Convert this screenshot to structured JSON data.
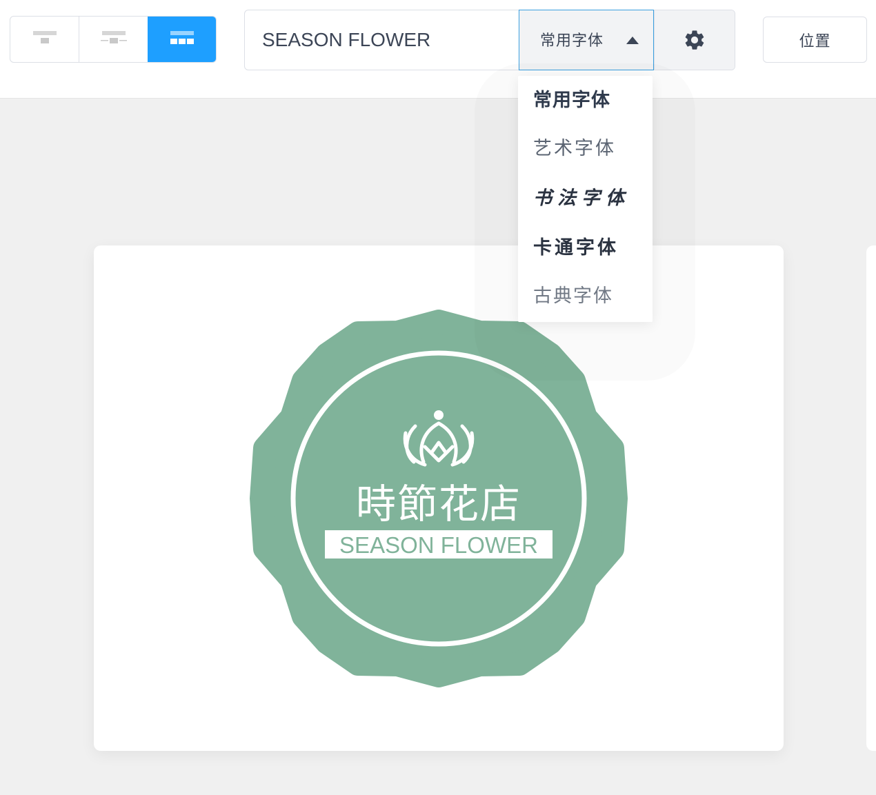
{
  "toolbar": {
    "layout_options": [
      {
        "name": "layout-top-icon",
        "active": false
      },
      {
        "name": "layout-center-icon",
        "active": false
      },
      {
        "name": "layout-grid-icon",
        "active": true
      }
    ],
    "text_value": "SEASON FLOWER",
    "font_select_label": "常用字体",
    "settings_icon": "gear-icon",
    "position_label": "位置"
  },
  "font_dropdown": {
    "items": [
      "常用字体",
      "艺术字体",
      "书法字体",
      "卡通字体",
      "古典字体"
    ],
    "selected": "常用字体"
  },
  "logo": {
    "chinese_name": "時節花店",
    "english_name": "SEASON FLOWER",
    "badge_color": "#80b39a",
    "fill_color": "#ffffff"
  },
  "colors": {
    "accent": "#1e9fff",
    "focus_border": "#3a9fe0",
    "text": "#3c4556"
  }
}
